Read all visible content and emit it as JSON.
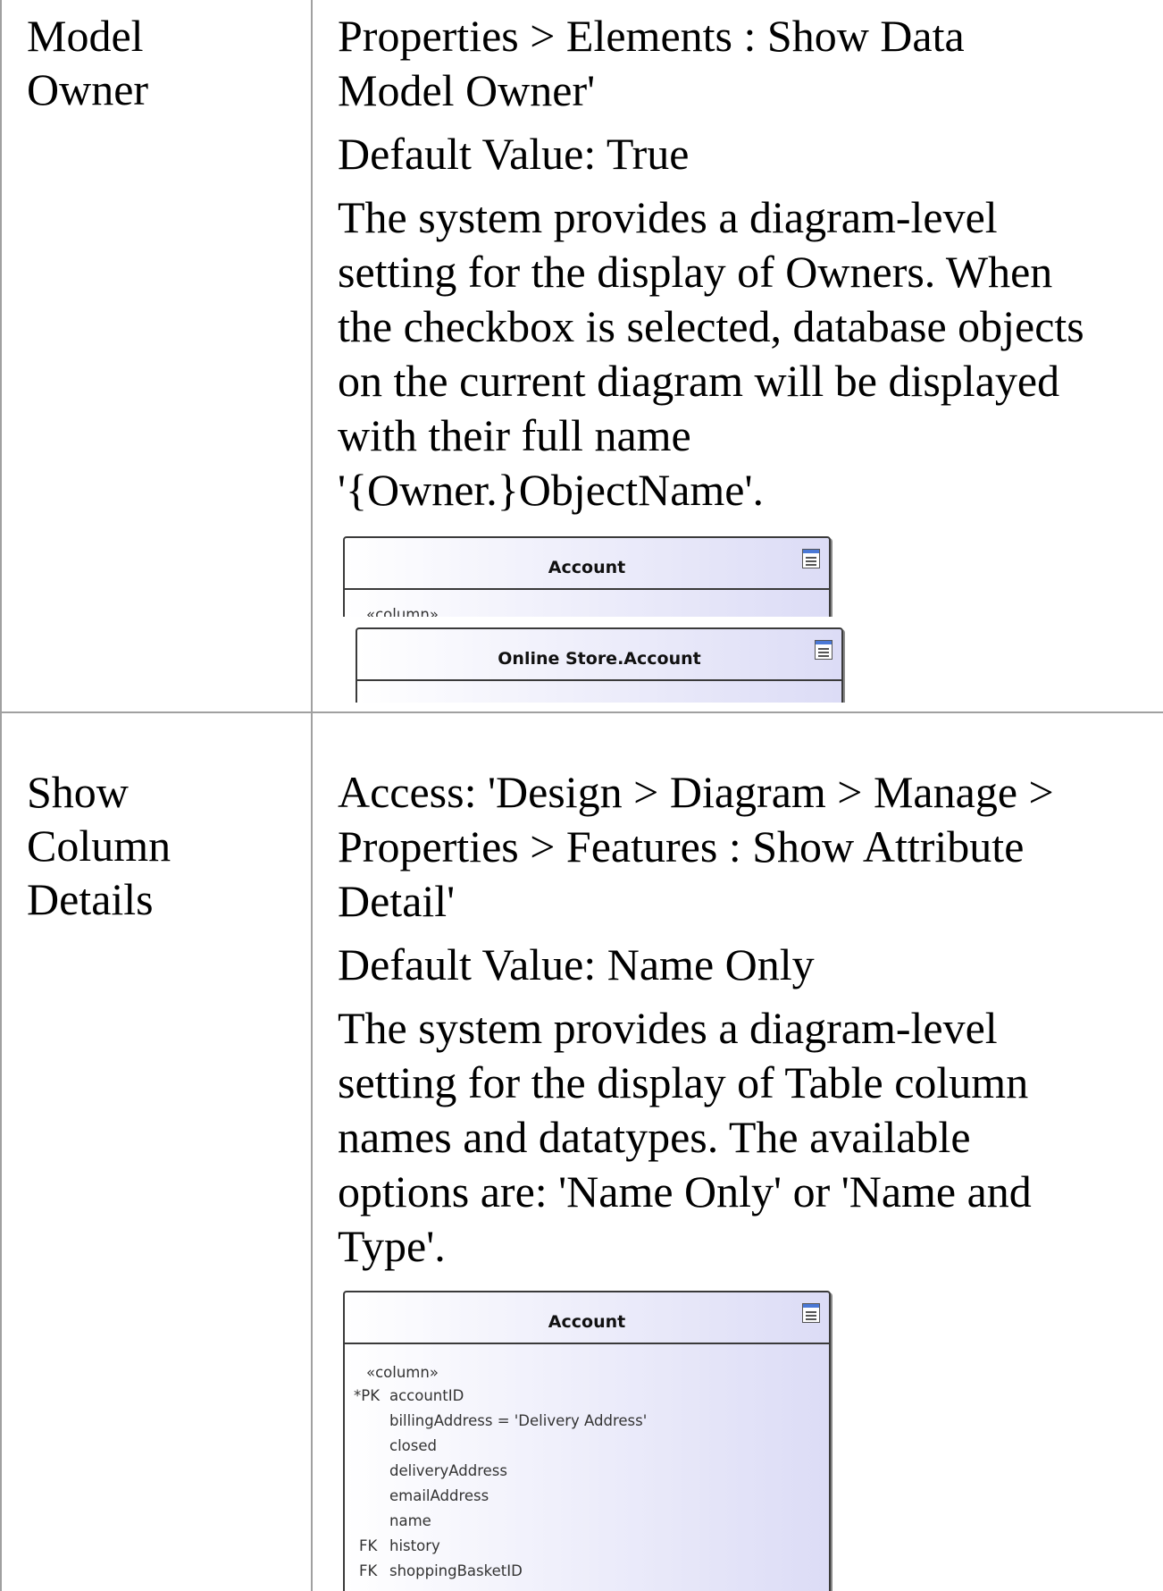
{
  "rows": [
    {
      "label_lines": [
        "Model",
        "Owner"
      ],
      "lines": [
        "Properties > Elements : Show Data",
        "Model Owner'",
        "Default Value: True",
        "The system provides a diagram-level",
        "setting for the display of Owners. When",
        "the checkbox is selected, database objects",
        "on the current diagram will be displayed",
        "with their full name",
        "'{Owner.}ObjectName'."
      ],
      "diagram_a": {
        "title": "Account",
        "stereotype": "«column»"
      },
      "diagram_b": {
        "title": "Online Store.Account"
      }
    },
    {
      "label_lines": [
        "Show",
        "Column",
        "Details"
      ],
      "lines": [
        "Access: 'Design > Diagram > Manage >",
        "Properties > Features : Show Attribute",
        "Detail'",
        "Default Value: Name Only",
        "The system provides a diagram-level",
        "setting for the display of Table column",
        "names and datatypes. The available",
        "options are: 'Name Only' or 'Name and",
        "Type'."
      ],
      "diagram": {
        "title": "Account",
        "stereotype": "«column»",
        "columns": [
          {
            "key": "*PK",
            "name": "accountID"
          },
          {
            "key": "",
            "name": "billingAddress = 'Delivery Address'"
          },
          {
            "key": "",
            "name": "closed"
          },
          {
            "key": "",
            "name": "deliveryAddress"
          },
          {
            "key": "",
            "name": "emailAddress"
          },
          {
            "key": "",
            "name": "name"
          },
          {
            "key": "FK",
            "name": "history"
          },
          {
            "key": "FK",
            "name": "shoppingBasketID"
          }
        ]
      }
    }
  ]
}
